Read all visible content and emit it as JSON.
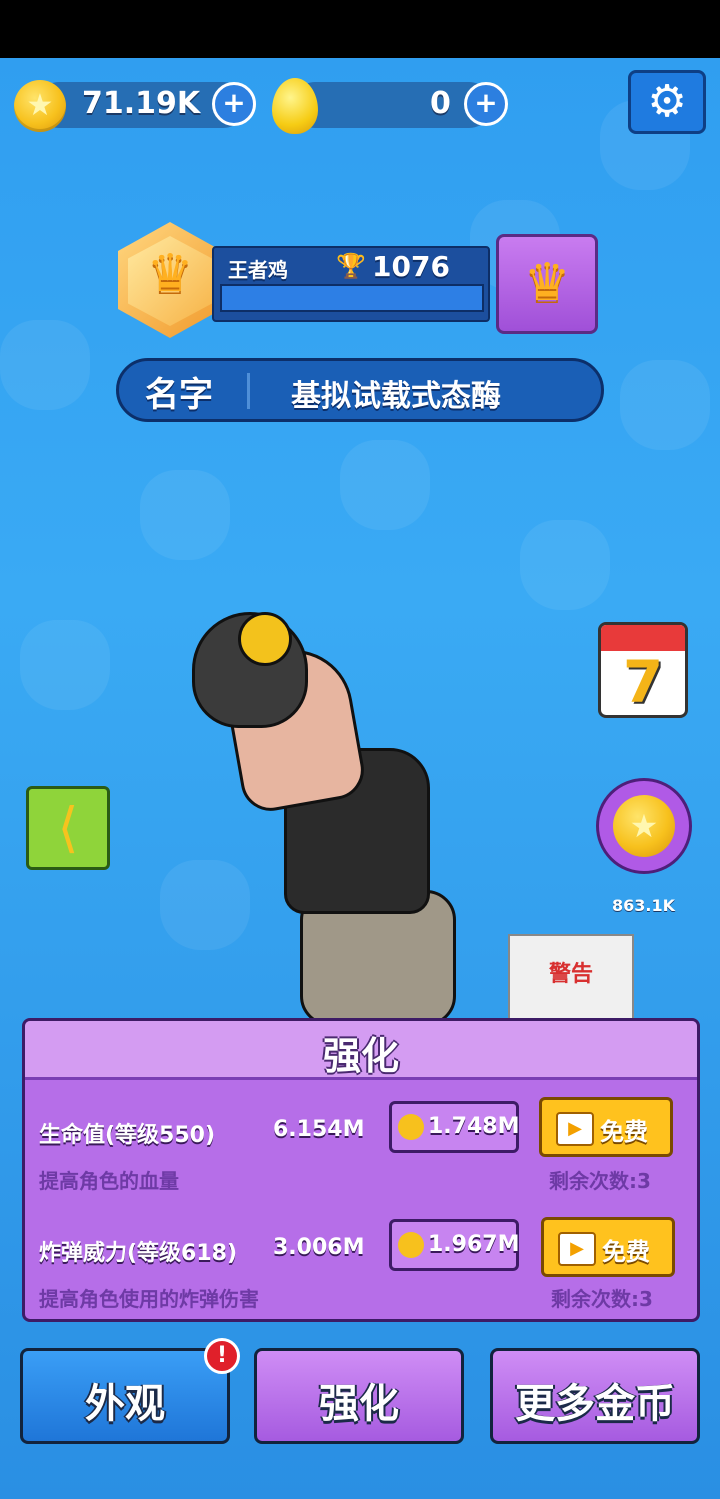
{
  "currency": {
    "gold_amount": "71.19K",
    "egg_amount": "0",
    "plus_glyph": "+"
  },
  "settings": {
    "icon": "gear-icon",
    "glyph": "⚙"
  },
  "profile": {
    "rank_name": "王者鸡",
    "trophy_icon": "trophy-icon",
    "trophy_glyph": "🏆",
    "trophies": "1076",
    "crown_glyph": "♛"
  },
  "name_bar": {
    "label": "名字",
    "value": "基拟试载式态酶"
  },
  "side": {
    "calendar_day": "7",
    "share_glyph": "⟨",
    "coin_reward": "863.1K",
    "coin_glyph": "★"
  },
  "scene": {
    "paper_text": "警告"
  },
  "upgrade_panel": {
    "title": "强化",
    "rows": [
      {
        "title": "生命值(等级550)",
        "value": "6.154M",
        "desc": "提高角色的血量",
        "cost": "1.748M",
        "free_label": "免费",
        "remaining": "剩余次数:3"
      },
      {
        "title": "炸弹威力(等级618)",
        "value": "3.006M",
        "desc": "提高角色使用的炸弹伤害",
        "cost": "1.967M",
        "free_label": "免费",
        "remaining": "剩余次数:3"
      }
    ],
    "play_glyph": "▶"
  },
  "tabs": [
    {
      "label": "外观",
      "alert": "!"
    },
    {
      "label": "强化"
    },
    {
      "label": "更多金币"
    }
  ],
  "colors": {
    "accent_blue": "#2f9df0",
    "panel_purple": "#b66ee8",
    "free_yellow": "#ffc21e"
  }
}
